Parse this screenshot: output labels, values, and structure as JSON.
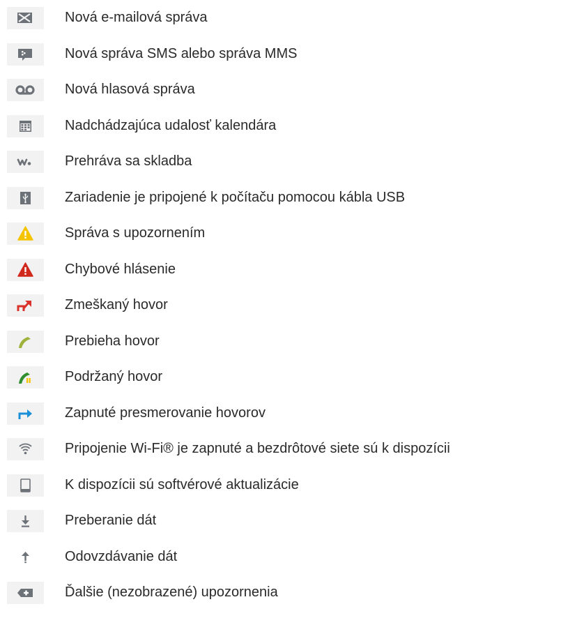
{
  "notifications": [
    {
      "icon": "envelope-icon",
      "label": "Nová e-mailová správa"
    },
    {
      "icon": "sms-mms-icon",
      "label": "Nová správa SMS alebo správa MMS"
    },
    {
      "icon": "voicemail-icon",
      "label": "Nová hlasová správa"
    },
    {
      "icon": "calendar-icon",
      "label": "Nadchádzajúca udalosť kalendára"
    },
    {
      "icon": "walkman-icon",
      "label": "Prehráva sa skladba"
    },
    {
      "icon": "usb-icon",
      "label": "Zariadenie je pripojené k počítaču pomocou kábla USB"
    },
    {
      "icon": "warning-icon",
      "label": "Správa s upozornením"
    },
    {
      "icon": "error-icon",
      "label": "Chybové hlásenie"
    },
    {
      "icon": "missed-call-icon",
      "label": "Zmeškaný hovor"
    },
    {
      "icon": "call-in-progress-icon",
      "label": "Prebieha hovor"
    },
    {
      "icon": "call-on-hold-icon",
      "label": "Podržaný hovor"
    },
    {
      "icon": "call-forwarding-icon",
      "label": "Zapnuté presmerovanie hovorov"
    },
    {
      "icon": "wifi-icon",
      "label": "Pripojenie Wi-Fi® je zapnuté a bezdrôtové siete sú k dispozícii"
    },
    {
      "icon": "software-update-icon",
      "label": "K dispozícii sú softvérové aktualizácie"
    },
    {
      "icon": "download-icon",
      "label": "Preberanie dát"
    },
    {
      "icon": "upload-icon",
      "label": "Odovzdávanie dát"
    },
    {
      "icon": "more-notifications-icon",
      "label": "Ďalšie (nezobrazené) upozornenia"
    }
  ],
  "colors": {
    "icon_background": "#f2f2f2",
    "icon_grey": "#6d7278",
    "warning_yellow": "#f5c400",
    "error_red": "#d0281b",
    "missed_call_red": "#d9322a",
    "call_green": "#9fb23c",
    "hold_green": "#2f8f2f",
    "forward_blue": "#1b8fd8"
  }
}
